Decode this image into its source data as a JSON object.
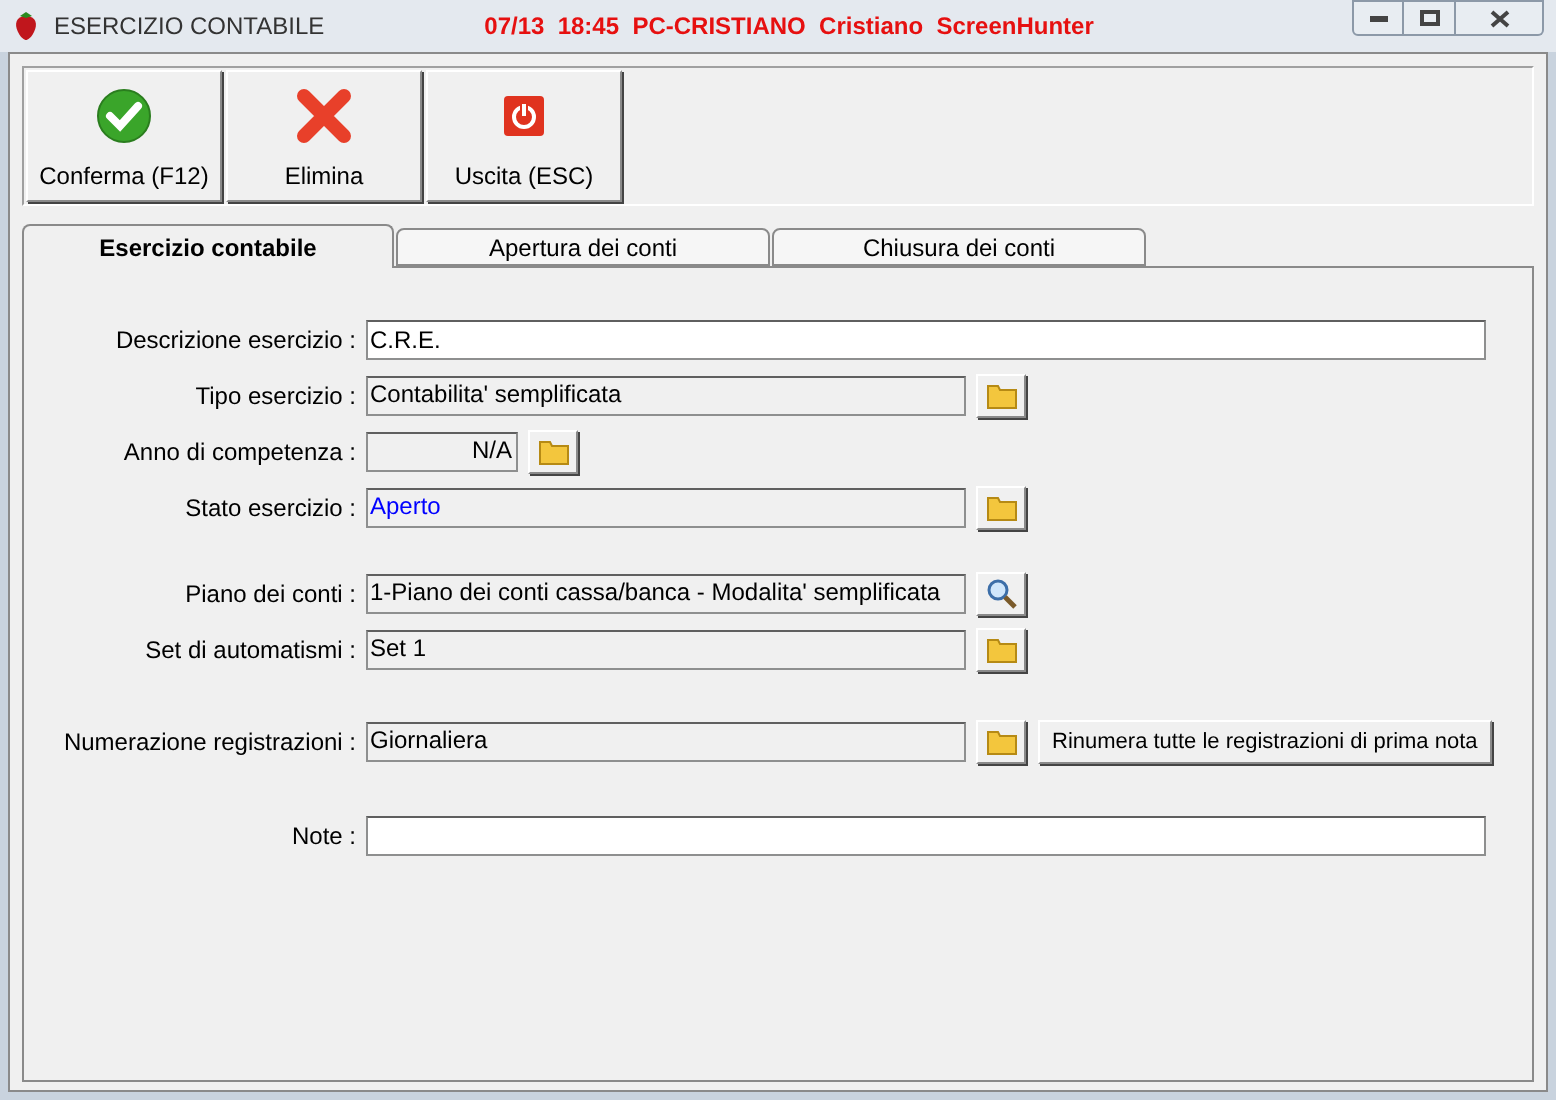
{
  "window": {
    "title": "ESERCIZIO CONTABILE",
    "info": "07/13  18:45  PC-CRISTIANO  Cristiano  ScreenHunter"
  },
  "toolbar": [
    {
      "label": "Conferma (F12)",
      "kind": "confirm"
    },
    {
      "label": "Elimina",
      "kind": "delete"
    },
    {
      "label": "Uscita (ESC)",
      "kind": "exit"
    }
  ],
  "tabs": [
    {
      "label": "Esercizio contabile",
      "selected": true
    },
    {
      "label": "Apertura dei conti",
      "selected": false
    },
    {
      "label": "Chiusura dei conti",
      "selected": false
    }
  ],
  "sections": [
    [
      {
        "label": "Descrizione esercizio :",
        "value": "C.R.E.",
        "kind": "input"
      },
      {
        "label": "Tipo esercizio :",
        "value": "Contabilita' semplificata",
        "kind": "readonly",
        "button": {
          "kind": "folder"
        }
      },
      {
        "label": "Anno di competenza :",
        "value": "N/A",
        "kind": "short",
        "button": {
          "kind": "folder"
        }
      },
      {
        "label": "Stato esercizio :",
        "value": "Aperto",
        "kind": "readonly",
        "button": {
          "kind": "folder"
        },
        "color": "#0000ff"
      }
    ],
    [
      {
        "label": "Piano dei conti :",
        "value": "1-Piano dei conti cassa/banca - Modalita' semplificata",
        "kind": "readonly",
        "button": {
          "kind": "search"
        }
      },
      {
        "label": "Set di automatismi :",
        "value": "Set 1",
        "kind": "readonly",
        "button": {
          "kind": "folder"
        }
      }
    ],
    [
      {
        "label": "Numerazione registrazioni :",
        "value": "Giornaliera",
        "kind": "readonly",
        "button": {
          "kind": "folder"
        },
        "extra_button": "Rinumera tutte le registrazioni di prima nota"
      }
    ],
    [
      {
        "label": "Note :",
        "kind": "input"
      }
    ]
  ]
}
